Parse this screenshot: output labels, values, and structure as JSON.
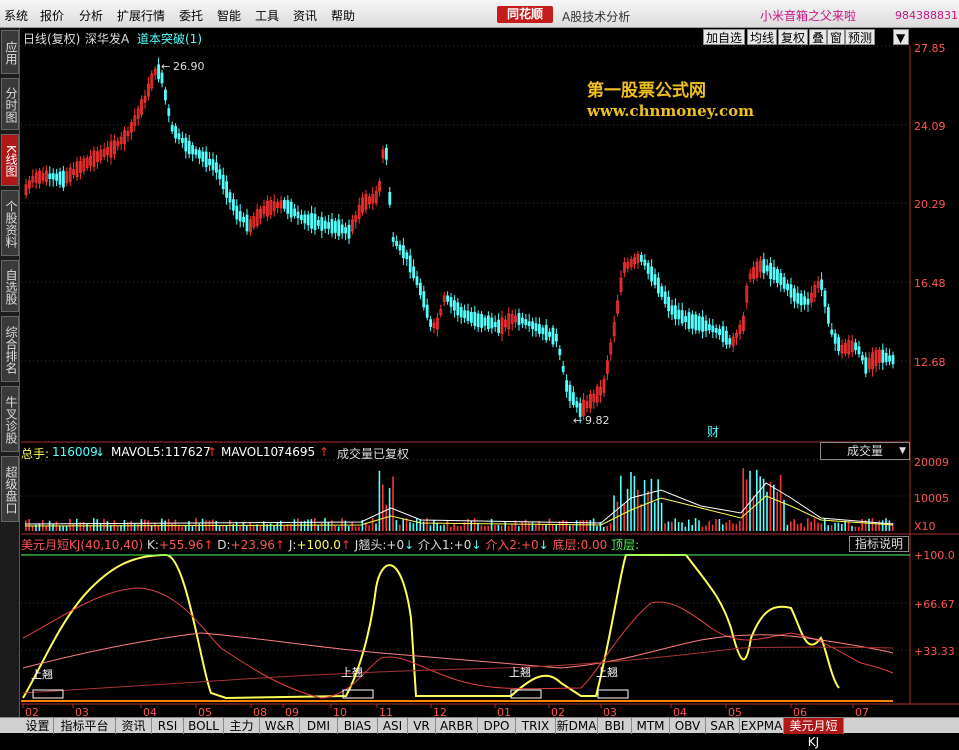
{
  "menu": {
    "items": [
      "系统",
      "报价",
      "分析",
      "扩展行情",
      "委托",
      "智能",
      "工具",
      "资讯",
      "帮助"
    ]
  },
  "brand": {
    "logo": "同花顺",
    "app_title": "A股技术分析",
    "promo": "小米音箱之父来啦",
    "user_id": "984388831"
  },
  "side_tabs": [
    "应用",
    "分时图",
    "K线图",
    "个股资料",
    "自选股",
    "综合排名",
    "牛叉诊股",
    "超级盘口"
  ],
  "price_panel": {
    "period_label": "日线(复权)",
    "stock_name": "深华发A",
    "indicator": "道本突破(1)",
    "buttons": [
      "加自选",
      "均线",
      "复权",
      "叠",
      "窗",
      "预测"
    ],
    "high_label": "26.90",
    "low_label": "9.82",
    "ylabels": [
      "27.85",
      "24.09",
      "20.29",
      "16.48",
      "12.68"
    ],
    "cai_label": "财",
    "watermark1": "第一股票公式网",
    "watermark2": "www.chnmoney.com"
  },
  "volume_panel": {
    "total_label": "总手:",
    "total_value": "116009",
    "mavol5_label": "MAVOL5:",
    "mavol5_value": "117627",
    "mavol10_label": "MAVOL10:",
    "mavol10_value": "74695",
    "note": "成交量已复权",
    "selector": "成交量",
    "ylabels": [
      "20009",
      "10005"
    ],
    "unit": "X10"
  },
  "indicator_panel": {
    "name": "美元月短KJ(40,10,40)",
    "k_label": "K:",
    "k_value": "+55.96",
    "d_label": "D:",
    "d_value": "+23.96",
    "j_label": "J:",
    "j_value": "+100.0",
    "jtou_label": "J翘头:",
    "jtou_value": "+0",
    "jieru1_label": "介入1:",
    "jieru1_value": "+0",
    "jieru2_label": "介入2:",
    "jieru2_value": "+0",
    "dice_label": "底层:",
    "dice_value": "0.00",
    "dingceng_label": "顶层:",
    "explain_btn": "指标说明",
    "ylabels": [
      "+100.0",
      "+66.67",
      "+33.33"
    ],
    "marker_text": "上翘"
  },
  "x_axis": [
    "02",
    "03",
    "04",
    "05",
    "08",
    "09",
    "10",
    "11",
    "12",
    "01",
    "02",
    "03",
    "04",
    "05",
    "06",
    "07"
  ],
  "bottom_tabs": [
    "设置",
    "指标平台",
    "资讯",
    "RSI",
    "BOLL",
    "主力",
    "W&R",
    "DMI",
    "BIAS",
    "ASI",
    "VR",
    "ARBR",
    "DPO",
    "TRIX",
    "新DMA",
    "BBI",
    "MTM",
    "OBV",
    "SAR",
    "EXPMA",
    "美元月短KJ"
  ],
  "colors": {
    "up": "#ff3333",
    "down": "#54ffff",
    "yellow": "#ffff55",
    "axis": "#b03030",
    "pink": "#ff80ff"
  }
}
